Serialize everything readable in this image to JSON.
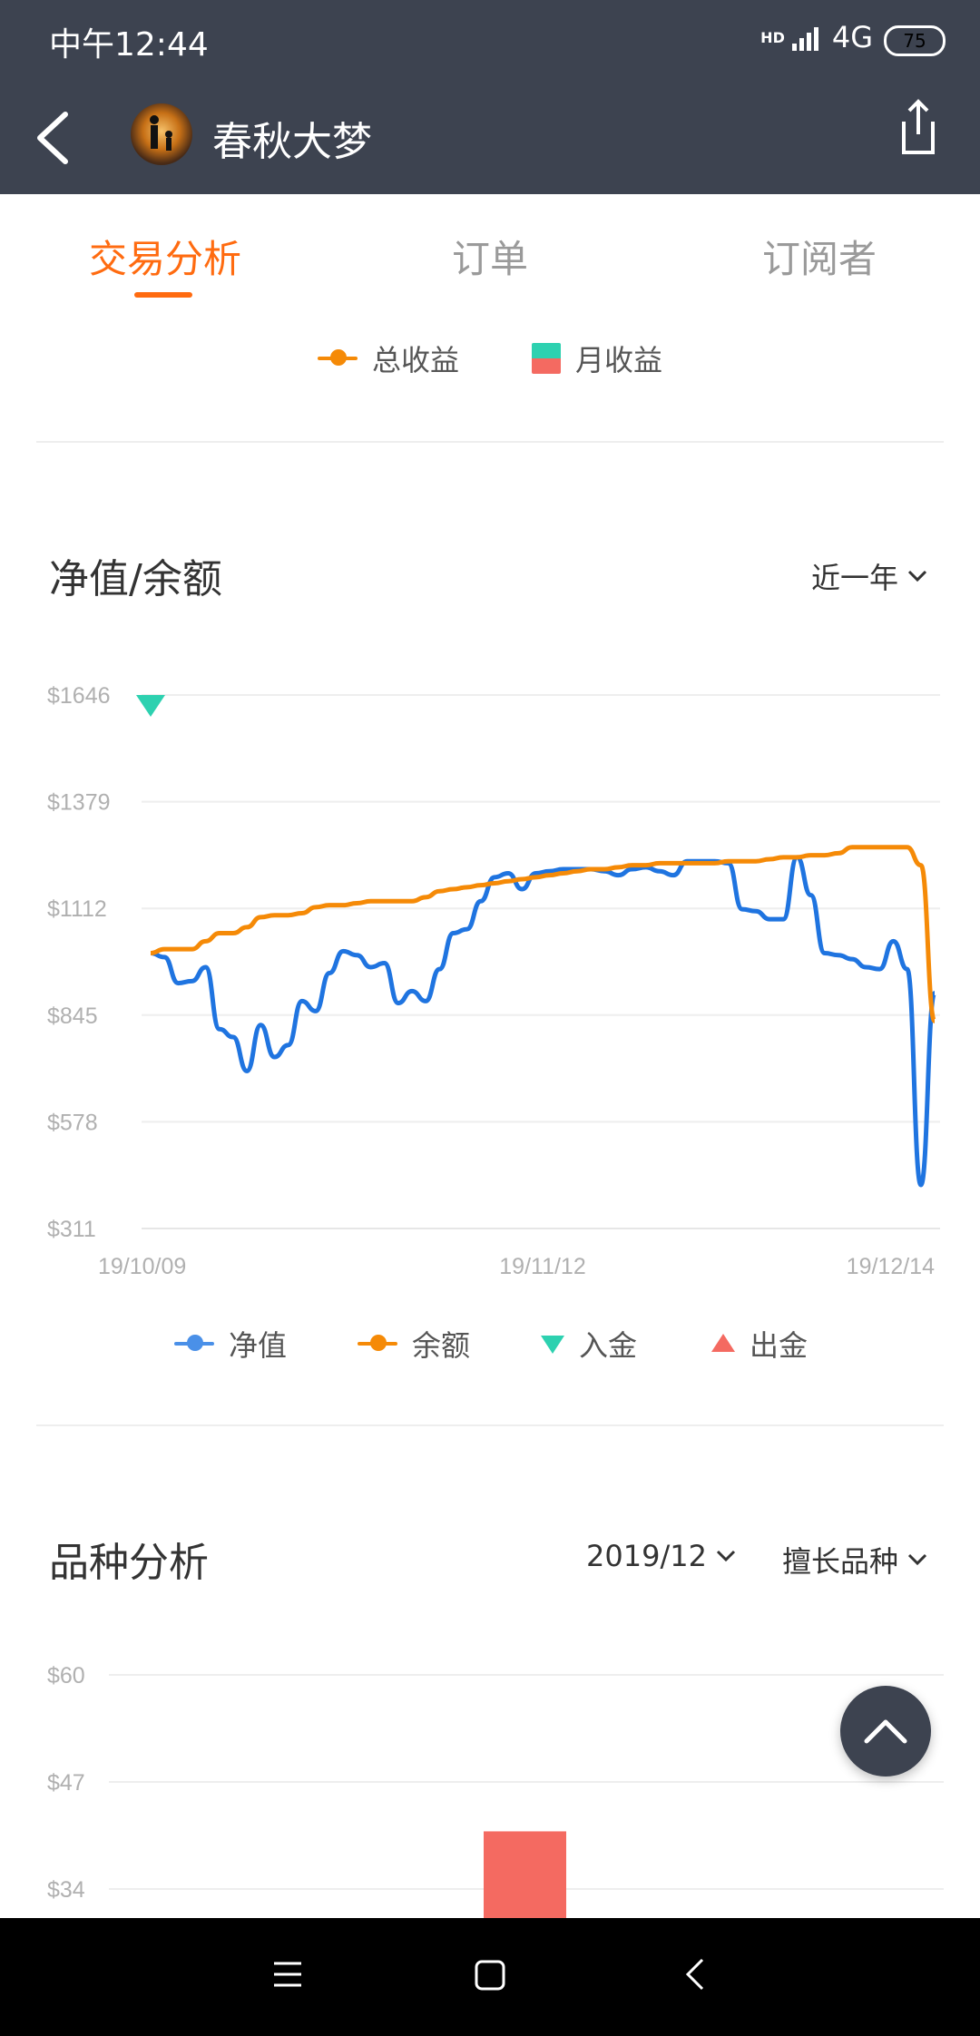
{
  "status": {
    "time": "中午12:44",
    "network": "4G",
    "battery": "75",
    "hd": "HD"
  },
  "header": {
    "title": "春秋大梦"
  },
  "tabs": [
    {
      "label": "交易分析",
      "active": true
    },
    {
      "label": "订单",
      "active": false
    },
    {
      "label": "订阅者",
      "active": false
    }
  ],
  "legend_top": {
    "total": "总收益",
    "monthly": "月收益"
  },
  "nav_section": {
    "title": "净值/余额",
    "range": "近一年"
  },
  "chart_data": [
    {
      "type": "line",
      "title": "净值/余额",
      "x_labels": [
        "19/10/09",
        "19/11/12",
        "19/12/14"
      ],
      "y_ticks": [
        "$311",
        "$578",
        "$845",
        "$1112",
        "$1379",
        "$1646"
      ],
      "ylim": [
        311,
        1646
      ],
      "series": [
        {
          "name": "净值",
          "color": "#1f74e0",
          "values": [
            1000,
            990,
            925,
            930,
            965,
            810,
            790,
            705,
            820,
            740,
            770,
            880,
            855,
            950,
            1005,
            995,
            965,
            975,
            875,
            905,
            880,
            960,
            1050,
            1060,
            1130,
            1190,
            1200,
            1160,
            1200,
            1205,
            1210,
            1210,
            1210,
            1205,
            1195,
            1210,
            1215,
            1205,
            1195,
            1230,
            1230,
            1230,
            1225,
            1110,
            1105,
            1085,
            1085,
            1240,
            1145,
            1000,
            995,
            985,
            965,
            960,
            1030,
            960,
            420,
            900
          ]
        },
        {
          "name": "余额",
          "color": "#f58a07",
          "values": [
            1000,
            1010,
            1010,
            1010,
            1030,
            1050,
            1050,
            1065,
            1090,
            1095,
            1095,
            1100,
            1115,
            1120,
            1120,
            1125,
            1130,
            1130,
            1130,
            1130,
            1140,
            1155,
            1160,
            1165,
            1170,
            1175,
            1180,
            1185,
            1190,
            1195,
            1200,
            1205,
            1210,
            1210,
            1215,
            1220,
            1220,
            1225,
            1225,
            1225,
            1225,
            1225,
            1230,
            1230,
            1230,
            1235,
            1240,
            1240,
            1245,
            1245,
            1250,
            1265,
            1265,
            1265,
            1265,
            1265,
            1220,
            830
          ]
        }
      ],
      "deposits": [
        {
          "x_index": 0,
          "label": "入金"
        }
      ],
      "withdrawals": [],
      "legend": [
        "净值",
        "余额",
        "入金",
        "出金"
      ],
      "colors": {
        "net": "#1f74e0",
        "balance": "#f58a07",
        "deposit": "#2dd1b0",
        "withdraw": "#f46a61"
      }
    },
    {
      "type": "bar",
      "title": "品种分析",
      "y_ticks": [
        "$34",
        "$47",
        "$60"
      ],
      "ylim": [
        34,
        60
      ],
      "values": [
        41
      ],
      "color": "#f46a61"
    }
  ],
  "legend_bottom": {
    "net": "净值",
    "balance": "余额",
    "deposit": "入金",
    "withdraw": "出金"
  },
  "variety_section": {
    "title": "品种分析",
    "month": "2019/12",
    "filter": "擅长品种"
  }
}
